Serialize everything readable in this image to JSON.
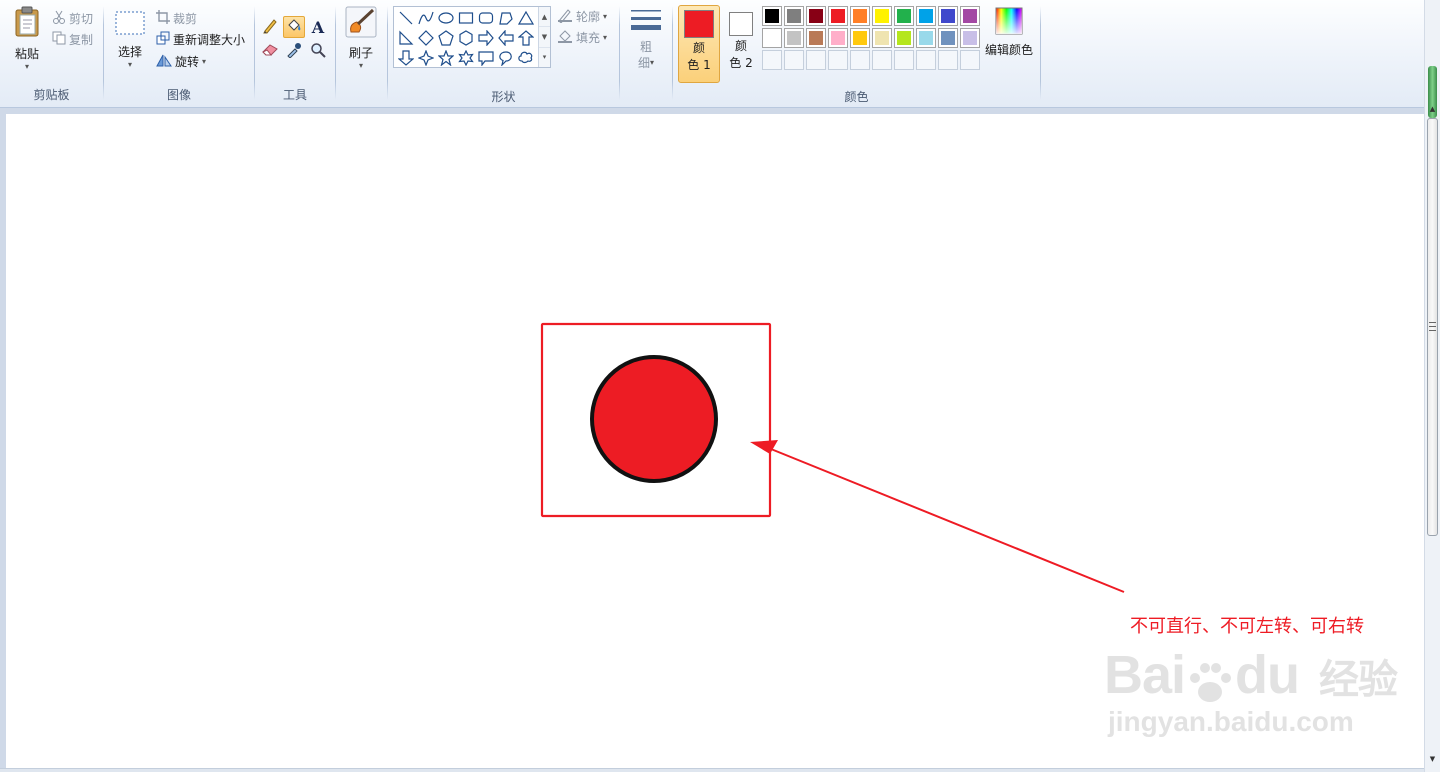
{
  "clipboard": {
    "group_label": "剪贴板",
    "paste": "粘贴",
    "cut": "剪切",
    "copy": "复制"
  },
  "image": {
    "group_label": "图像",
    "select": "选择",
    "crop": "裁剪",
    "resize": "重新调整大小",
    "rotate": "旋转"
  },
  "tools": {
    "group_label": "工具",
    "text_tool_glyph": "A",
    "items": [
      "pencil-icon",
      "fill-bucket-icon",
      "text-icon",
      "eraser-icon",
      "color-picker-icon",
      "magnifier-icon"
    ],
    "active": "fill-bucket-icon"
  },
  "brushes": {
    "label": "刷子"
  },
  "shapes": {
    "group_label": "形状",
    "outline": "轮廓",
    "fill": "填充"
  },
  "size": {
    "label_line1": "粗",
    "label_line2": "细"
  },
  "colors": {
    "group_label": "颜色",
    "color1_line1": "颜",
    "color1_line2": "色 1",
    "color1_value": "#ed1c24",
    "color2_line1": "颜",
    "color2_line2": "色 2",
    "color2_value": "#ffffff",
    "edit_colors": "编辑颜色",
    "palette_row1": [
      "#000000",
      "#7f7f7f",
      "#880015",
      "#ed1c24",
      "#ff7f27",
      "#fff200",
      "#22b14c",
      "#00a2e8",
      "#3f48cc",
      "#a349a4"
    ],
    "palette_row2": [
      "#ffffff",
      "#c3c3c3",
      "#b97a57",
      "#ffaec9",
      "#ffc90e",
      "#efe4b0",
      "#b5e61d",
      "#99d9ea",
      "#7092be",
      "#c8bfe7"
    ],
    "accent": "#ed1c24"
  },
  "canvas": {
    "annotation_text": "不可直行、不可左转、可右转",
    "circle_fill": "#ed1c24",
    "frame_color": "#ed1c24",
    "watermark_brand": "Bai",
    "watermark_brand2": "du",
    "watermark_cn": "经验",
    "watermark_url": "jingyan.baidu.com"
  }
}
